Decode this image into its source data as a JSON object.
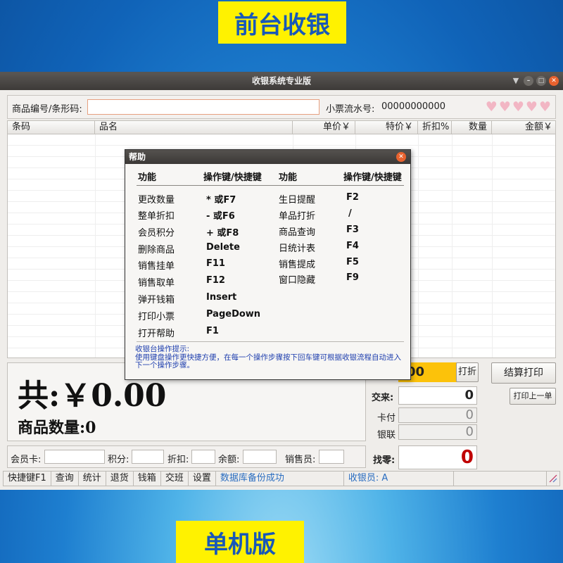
{
  "banners": {
    "top": "前台收银",
    "bottom": "单机版"
  },
  "window": {
    "title": "收银系统专业版"
  },
  "search": {
    "label": "商品编号/条形码:",
    "value": "",
    "receipt_label": "小票流水号:",
    "receipt_no": "00000000000",
    "hearts": [
      "♥",
      "♥",
      "♥",
      "♥",
      "♥"
    ]
  },
  "table": {
    "columns": [
      "条码",
      "品名",
      "单价￥",
      "特价￥",
      "折扣%",
      "数量",
      "金额￥"
    ]
  },
  "totals": {
    "total_label": "共:￥0.00",
    "qty_label": "商品数量:0"
  },
  "payment": {
    "discount_value": "00",
    "discount_button": "打折",
    "cash_label": "交来:",
    "cash_value": "0",
    "card_label": "卡付",
    "card_value": "0",
    "unionpay_label": "银联",
    "unionpay_value": "0",
    "change_label": "找零:",
    "change_value": "0",
    "checkout_button": "结算打印",
    "reprint_button": "打印上一单"
  },
  "member": {
    "card_label": "会员卡:",
    "points_label": "积分:",
    "discount_label": "折扣:",
    "balance_label": "余额:",
    "cashier_label": "销售员:"
  },
  "status": {
    "items": [
      "快捷键F1",
      "查询",
      "统计",
      "退货",
      "钱箱",
      "交班",
      "设置"
    ],
    "message": "数据库备份成功",
    "cashier": "收银员: A"
  },
  "help": {
    "title": "帮助",
    "col_func": "功能",
    "col_key": "操作键/快捷键",
    "left": [
      {
        "func": "更改数量",
        "key": "* 或F7"
      },
      {
        "func": "整单折扣",
        "key": "- 或F6"
      },
      {
        "func": "会员积分",
        "key": "+ 或F8"
      },
      {
        "func": "删除商品",
        "key": "Delete"
      },
      {
        "func": "销售挂单",
        "key": "F11"
      },
      {
        "func": "销售取单",
        "key": "F12"
      },
      {
        "func": "弹开钱箱",
        "key": "Insert"
      },
      {
        "func": "打印小票",
        "key": "PageDown"
      },
      {
        "func": "打开帮助",
        "key": "F1"
      }
    ],
    "right": [
      {
        "func": "生日提醒",
        "key": "F2"
      },
      {
        "func": "单品打折",
        "key": "/"
      },
      {
        "func": "商品查询",
        "key": "F3"
      },
      {
        "func": "日统计表",
        "key": "F4"
      },
      {
        "func": "销售提成",
        "key": "F5"
      },
      {
        "func": "窗口隐藏",
        "key": "F9"
      }
    ],
    "tips_title": "收银台操作提示:",
    "tips_body": "使用键盘操作更快捷方便，在每一个操作步骤按下回车键可根据收银流程自动进入下一个操作步骤。"
  }
}
